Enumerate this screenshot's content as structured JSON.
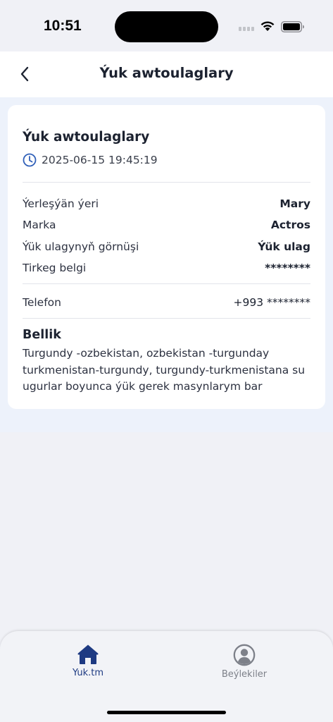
{
  "status_bar": {
    "time": "10:51"
  },
  "header": {
    "title": "Ýuk awtoulaglary",
    "back_icon": "chevron-left-icon"
  },
  "card": {
    "title": "Ýuk awtoulaglary",
    "datetime": "2025-06-15 19:45:19",
    "details": [
      {
        "label": "Ýerleşýän ýeri",
        "value": "Mary"
      },
      {
        "label": "Marka",
        "value": "Actros"
      },
      {
        "label": "Ýük ulagynyň görnüşi",
        "value": "Ýük ulag"
      },
      {
        "label": "Tirkeg belgi",
        "value": "********"
      }
    ],
    "phone": {
      "label": "Telefon",
      "value": "+993 ********"
    },
    "note": {
      "title": "Bellik",
      "text": "Turgundy -ozbekistan, ozbekistan -turgunday turkmenistan-turgundy, turgundy-turkmenistana su ugurlar boyunca ýük gerek  masynlarym bar"
    }
  },
  "tab_bar": {
    "tabs": [
      {
        "label": "Yuk.tm",
        "icon": "home-icon",
        "active": true
      },
      {
        "label": "Beýlekiler",
        "icon": "user-circle-icon",
        "active": false
      }
    ]
  },
  "colors": {
    "accent": "#1e3a82",
    "inactive": "#7d8089",
    "clock": "#2f5fb8"
  }
}
